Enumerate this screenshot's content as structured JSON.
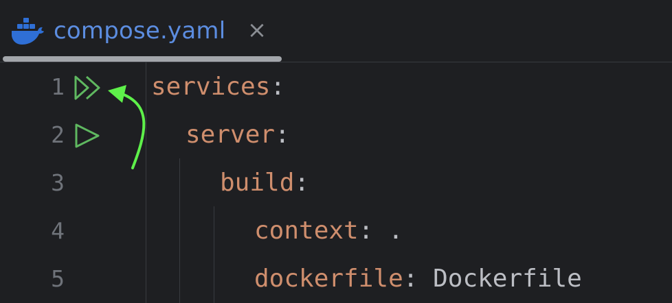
{
  "tab": {
    "title": "compose.yaml",
    "close_glyph": "×",
    "icon": "docker-whale-icon"
  },
  "gutter": {
    "line_numbers": [
      "1",
      "2",
      "3",
      "4",
      "5"
    ],
    "run_icons": [
      "run-all-services-icon",
      "run-service-icon"
    ]
  },
  "code": {
    "lines": [
      {
        "key": "services",
        "sep": ":",
        "value": ""
      },
      {
        "key": "server",
        "sep": ":",
        "value": ""
      },
      {
        "key": "build",
        "sep": ":",
        "value": ""
      },
      {
        "key": "context",
        "sep": ":",
        "value": " ."
      },
      {
        "key": "dockerfile",
        "sep": ":",
        "value": " Dockerfile"
      }
    ]
  },
  "colors": {
    "background": "#1e1f22",
    "tab_title": "#5c8de0",
    "key": "#cf8e6d",
    "text": "#bcbec4",
    "line_number": "#6f737a",
    "run_icon": "#5fb860",
    "annotation_arrow": "#5ef04a"
  }
}
